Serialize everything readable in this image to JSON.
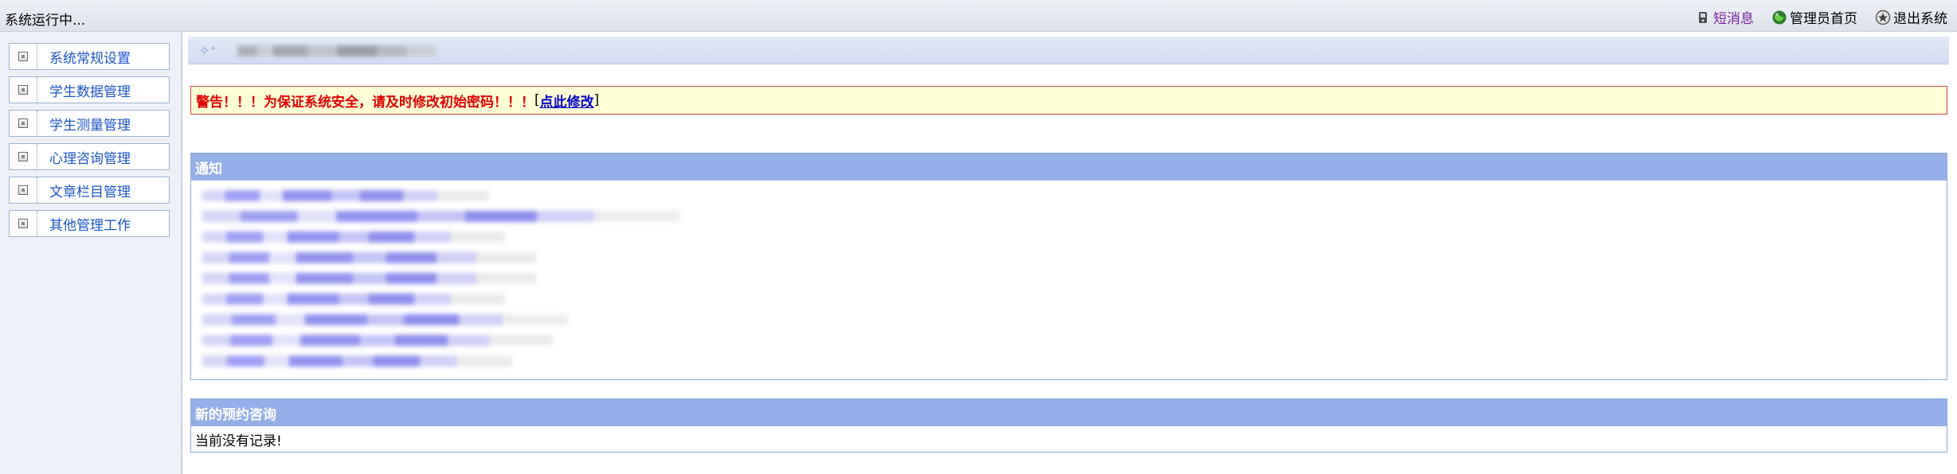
{
  "topbar": {
    "status": "系统运行中...",
    "links": [
      {
        "label": "短消息",
        "icon": "message-icon",
        "color": "#7a1fa2"
      },
      {
        "label": "管理员首页",
        "icon": "globe-icon",
        "color": "#000000"
      },
      {
        "label": "退出系统",
        "icon": "exit-icon",
        "color": "#000000"
      }
    ]
  },
  "sidebar": {
    "items": [
      {
        "label": "系统常规设置"
      },
      {
        "label": "学生数据管理"
      },
      {
        "label": "学生测量管理"
      },
      {
        "label": "心理咨询管理"
      },
      {
        "label": "文章栏目管理"
      },
      {
        "label": "其他管理工作"
      }
    ]
  },
  "warning": {
    "text": "警告！！！为保证系统安全，请及时修改初始密码！！！",
    "open_bracket": "[",
    "link": "点此修改",
    "close_bracket": "]"
  },
  "notice": {
    "title": "通知"
  },
  "appointments": {
    "title": "新的预约咨询",
    "empty": "当前没有记录!"
  },
  "colors": {
    "panel_header": "#95b0e8",
    "warning_text": "#e00000",
    "menu_text": "#1a55c6"
  }
}
